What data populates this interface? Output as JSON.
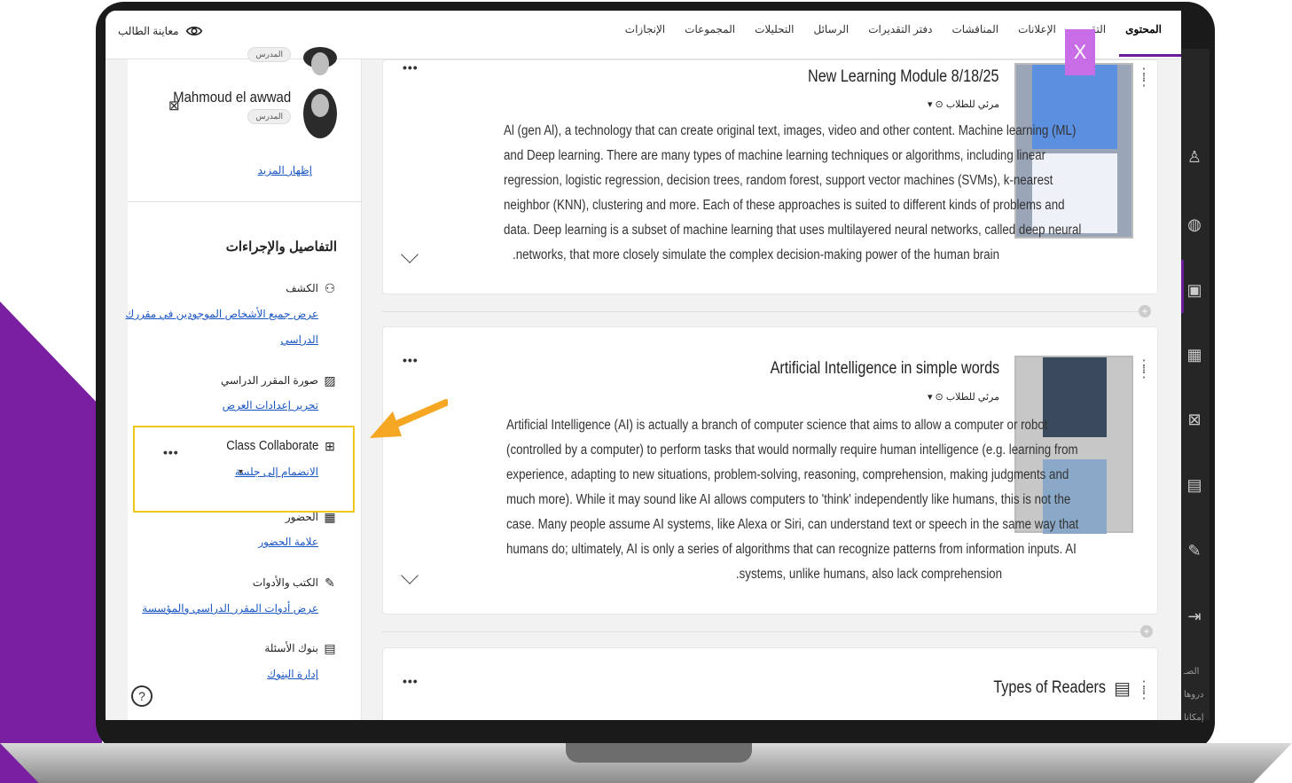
{
  "topbar": {
    "tabs": [
      "المحتوى",
      "التقويم",
      "الإعلانات",
      "المناقشات",
      "دفتر التقديرات",
      "الرسائل",
      "التحليلات",
      "المجموعات",
      "الإنجازات"
    ],
    "preview_label": "معاينة الطالب",
    "close_label": "X"
  },
  "leftpanel": {
    "role_top": "المدرس",
    "instructor_name": "Mahmoud el awwad",
    "instructor_role": "المدرس",
    "show_more": "إظهار المزيد",
    "details_title": "التفاصيل والإجراءات",
    "roster_label": "الكشف",
    "roster_link1": "عرض جميع الأشخاص الموجودين في مقررك",
    "roster_link2": "الدراسي",
    "course_image_label": "صورة المقرر الدراسي",
    "course_image_link": "تحرير إعدادات العرض",
    "collab_label": "Class Collaborate",
    "collab_link": "الانضمام إلى جلسة",
    "collab_caret": "▾",
    "attendance_label": "الحضور",
    "attendance_link": "علامة الحضور",
    "books_label": "الكتب والأدوات",
    "books_link": "عرض أدوات المقرر الدراسي والمؤسسة",
    "banks_label": "بنوك الأسئلة",
    "banks_link": "إدارة البنوك",
    "dots": "•••"
  },
  "content": {
    "card1": {
      "title": "New Learning Module 8/18/25",
      "visibility": "▾ ⊙ مرئي للطلاب",
      "lines": [
        "Al (gen Al), a technology that can create original text, images, video and other content. Machine learning (ML)",
        "and Deep learning. There are many types of machine learning techniques or algorithms, including linear",
        "regression, logistic regression, decision trees, random forest, support vector machines (SVMs), k-nearest",
        "neighbor (KNN), clustering and more. Each of these approaches is suited to different kinds of problems and",
        "data. Deep learning is a subset of machine learning that uses multilayered neural networks, called deep neural",
        ".networks, that more closely simulate the complex decision-making power of the human brain"
      ]
    },
    "card2": {
      "title": "Artificial Intelligence in simple words",
      "visibility": "▾ ⊙ مرئي للطلاب",
      "lines": [
        "Artificial Intelligence (AI) is actually a branch of computer science that aims to allow a computer or robot",
        "(controlled by a computer) to perform tasks that would normally require human intelligence (e.g. learning from",
        "experience, adapting to new situations, problem-solving, reasoning, comprehension, making judgments and",
        "much more). While it may sound like AI allows computers to 'think' independently like humans, this is not the",
        "case. Many people assume AI systems, like Alexa or Siri, can understand text or speech in the same way that",
        "humans do; ultimately, AI is only a series of algorithms that can recognize patterns from information inputs. AI",
        ".systems, unlike humans, also lack comprehension"
      ]
    },
    "card3": {
      "title": "Types of Readers"
    },
    "dots": "•••"
  },
  "rail": {
    "labels": [
      "الصـ",
      "دروها",
      "إمكانا"
    ]
  },
  "colors": {
    "accent": "#6a1b9a",
    "highlight": "#f2c81a",
    "arrow": "#f5a623",
    "link": "#1a56c4"
  }
}
